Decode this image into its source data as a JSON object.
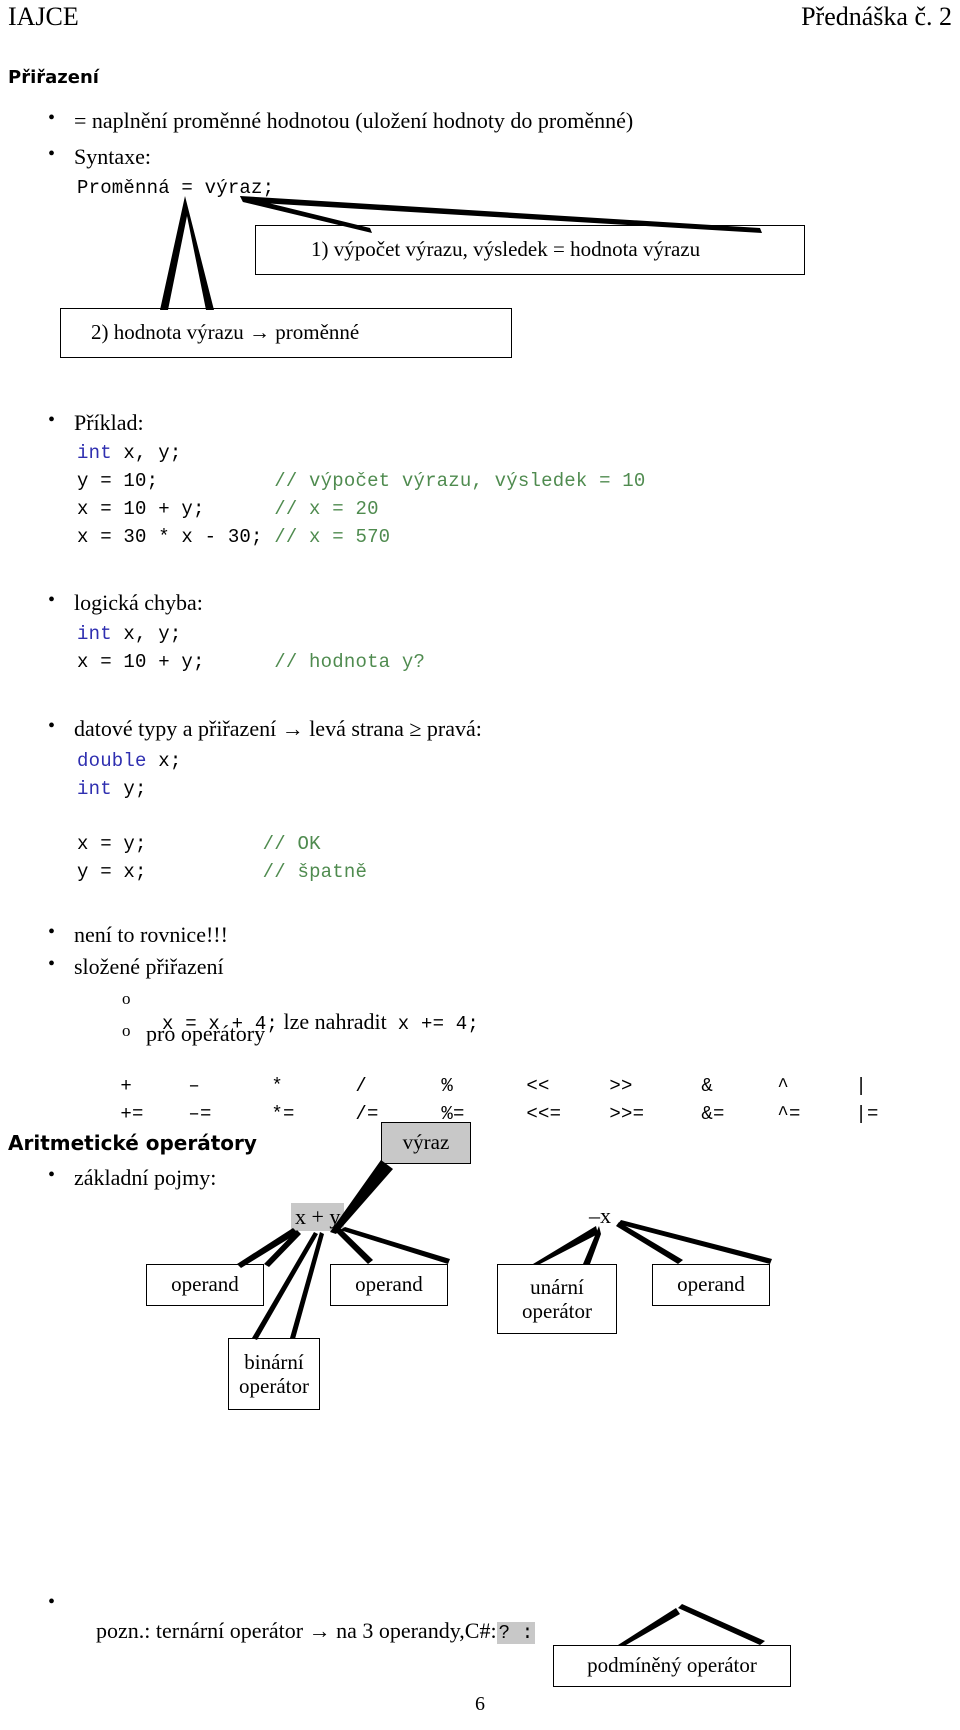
{
  "header": {
    "left": "IAJCE",
    "right": "Přednáška č. 2"
  },
  "section1": {
    "title": "Přiřazení",
    "bullets": [
      "= naplnění proměnné hodnotou (uložení hodnoty do proměnné)",
      "Syntaxe:"
    ],
    "syntax_code": "Proměnná = výraz;",
    "callout1": "1)   výpočet výrazu, výsledek = hodnota výrazu",
    "callout2": "2)   hodnota výrazu → proměnné"
  },
  "example": {
    "label": "Příklad:",
    "lines": [
      {
        "kw": "int",
        "code": " x, y;",
        "comment": ""
      },
      {
        "kw": "",
        "code": "y = 10;",
        "pad": "          ",
        "comment": "// výpočet výrazu, výsledek = 10"
      },
      {
        "kw": "",
        "code": "x = 10 + y;",
        "pad": "      ",
        "comment": "// x = 20"
      },
      {
        "kw": "",
        "code": "x = 30 * x - 30;",
        "pad": " ",
        "comment": "// x = 570"
      }
    ]
  },
  "logic_error": {
    "label": "logická chyba:",
    "lines": [
      {
        "kw": "int",
        "code": " x, y;",
        "comment": ""
      },
      {
        "kw": "",
        "code": "x = 10 + y;",
        "pad": "      ",
        "comment": "// hodnota y?"
      }
    ]
  },
  "types": {
    "label": "datové typy a přiřazení → levá strana ≥ pravá:",
    "decl": [
      {
        "kw": "double",
        "code": " x;"
      },
      {
        "kw": "int",
        "code": " y;"
      }
    ],
    "assign": [
      {
        "code": "x = y;",
        "pad": "          ",
        "comment": "// OK"
      },
      {
        "code": "y = x;",
        "pad": "          ",
        "comment": "// špatně"
      }
    ]
  },
  "notes": {
    "not_equation": "není to rovnice!!!",
    "compound": "složené přiřazení",
    "compound_sub1_code_a": "x = x + 4;",
    "compound_sub1_text": "lze nahradit",
    "compound_sub1_code_b": "x += 4;",
    "compound_sub2": "pro operátory",
    "operators_row1": [
      "+",
      "–",
      "*",
      "/",
      "%",
      "<<",
      ">>",
      "&",
      "^",
      "|"
    ],
    "operators_row2": [
      "+=",
      "–=",
      "*=",
      "/=",
      "%=",
      "<<=",
      ">>=",
      "&=",
      "^=",
      "|="
    ]
  },
  "section2": {
    "title": "Aritmetické operátory",
    "bullet": "základní pojmy:",
    "callout_vyraz": "výraz",
    "expr_binary": "x + y",
    "expr_unary": "–x",
    "boxes": {
      "operand_left": "operand",
      "operand_right": "operand",
      "binary_operator": "binární\noperátor",
      "unary_operator": "unární\noperátor",
      "operand_unary": "operand"
    }
  },
  "footer_note": {
    "text_before": "pozn.: ternární operátor → na 3 operandy,C#:",
    "highlight": "? :",
    "callout": "podmíněný operátor"
  },
  "page_number": "6"
}
